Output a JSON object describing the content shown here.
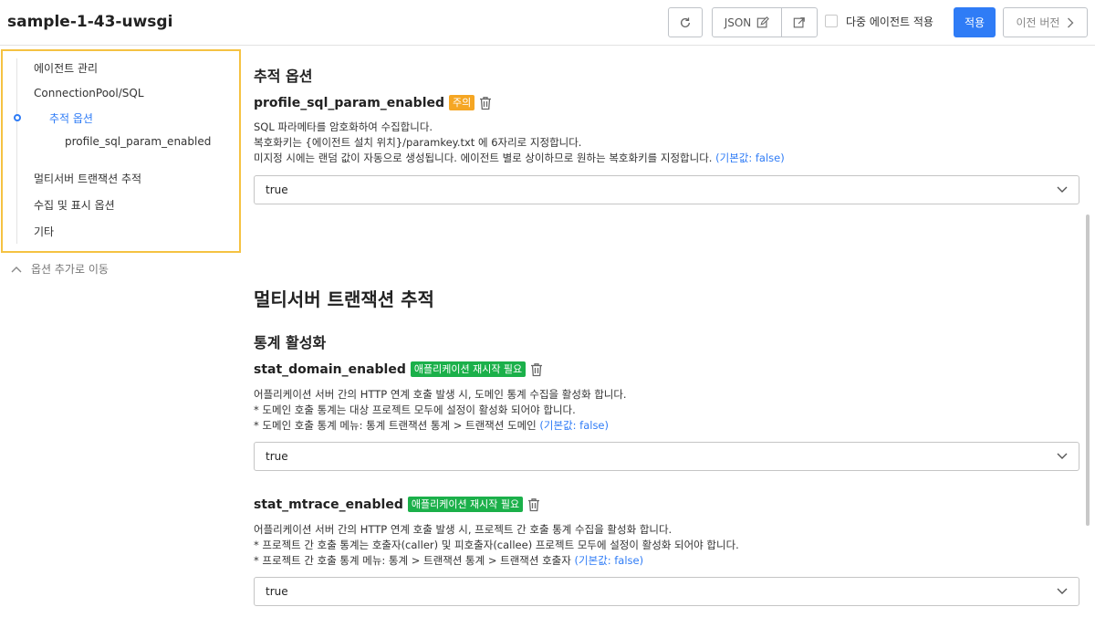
{
  "header": {
    "title": "sample-1-43-uwsgi",
    "json_label": "JSON",
    "multi_agent_label": "다중 에이전트 적용",
    "apply_label": "적용",
    "prev_version_label": "이전 버전"
  },
  "sidebar": {
    "items": [
      {
        "label": "에이전트 관리"
      },
      {
        "label": "ConnectionPool/SQL"
      },
      {
        "label": "추적 옵션"
      },
      {
        "label": "profile_sql_param_enabled"
      },
      {
        "label": "멀티서버 트랜잭션 추적"
      },
      {
        "label": "수집 및 표시 옵션"
      },
      {
        "label": "기타"
      }
    ],
    "move_link": "옵션 추가로 이동"
  },
  "sections": {
    "trace": {
      "title": "추적 옵션",
      "option": {
        "name": "profile_sql_param_enabled",
        "badge": "주의",
        "desc1": "SQL 파라메타를 암호화하여 수집합니다.",
        "desc2": "복호화키는 {에이전트 설치 위치}/paramkey.txt 에 6자리로 지정합니다.",
        "desc3": "미지정 시에는 랜덤 값이 자동으로 생성됩니다. 에이전트 별로 상이하므로 원하는 복호화키를 지정합니다.",
        "default": "(기본값: false)",
        "value": "true"
      }
    },
    "multiserver": {
      "title": "멀티서버 트랜잭션 추적",
      "subtitle": "통계 활성화",
      "domain": {
        "name": "stat_domain_enabled",
        "badge": "애플리케이션 재시작 필요",
        "desc1": "어플리케이션 서버 간의 HTTP 연계 호출 발생 시, 도메인 통계 수집을 활성화 합니다.",
        "desc2": "* 도메인 호출 통계는 대상 프로젝트 모두에 설정이 활성화 되어야 합니다.",
        "desc3": "* 도메인 호출 통계 메뉴: 통계 트랜잭션 통계 > 트랜잭션 도메인",
        "default": "(기본값: false)",
        "value": "true"
      },
      "mtrace": {
        "name": "stat_mtrace_enabled",
        "badge": "애플리케이션 재시작 필요",
        "desc1": "어플리케이션 서버 간의 HTTP 연계 호출 발생 시, 프로젝트 간 호출 통계 수집을 활성화 합니다.",
        "desc2": "* 프로젝트 간 호출 통계는 호출자(caller) 및 피호출자(callee) 프로젝트 모두에 설정이 활성화 되어야 합니다.",
        "desc3": "* 프로젝트 간 호출 통계 메뉴: 통계 > 트랜잭션 통계 > 트랜잭션 호출자",
        "default": "(기본값: false)",
        "value": "true"
      }
    }
  },
  "colors": {
    "accent": "#2f7cf6",
    "warn_badge": "#f5a623",
    "restart_badge": "#1bb04a",
    "sidebar_highlight": "#f5c242"
  },
  "icons": [
    "refresh-icon",
    "edit-icon",
    "external-link-icon",
    "chevron-right-icon",
    "chevron-up-icon",
    "trash-icon",
    "chevron-down-icon"
  ]
}
